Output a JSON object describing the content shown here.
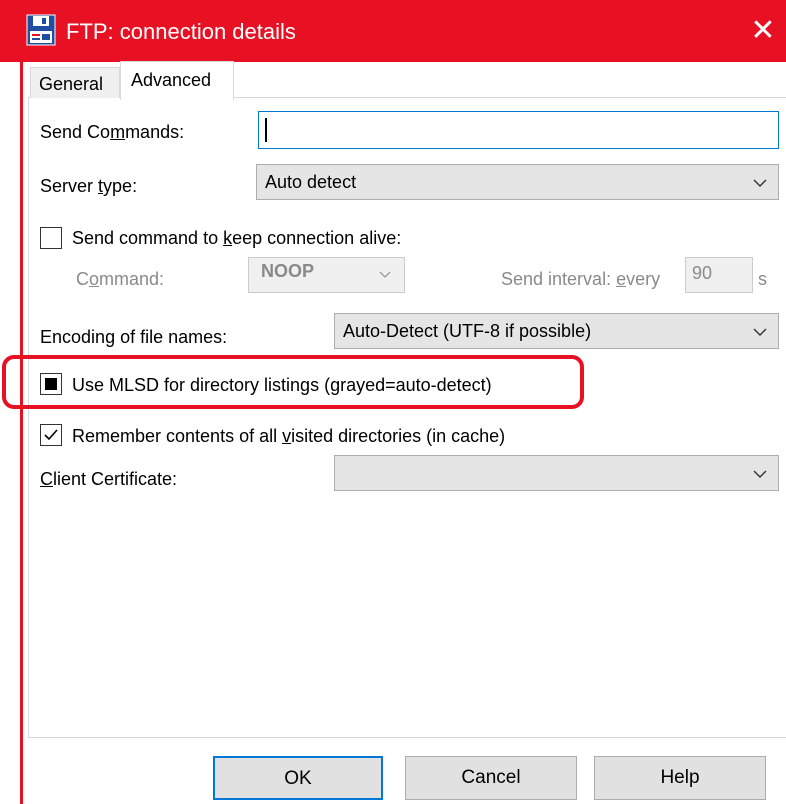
{
  "window": {
    "title": "FTP: connection details",
    "close_glyph": "✕",
    "accent_color": "#e81123",
    "icon": "floppy-disk-icon"
  },
  "tabs": [
    {
      "label": "General",
      "selected": false
    },
    {
      "label": "Advanced",
      "selected": true
    }
  ],
  "send_commands": {
    "label_pre": "Send Co",
    "label_u": "m",
    "label_post": "mands:",
    "value": ""
  },
  "server_type": {
    "label_pre": "Server ",
    "label_u": "t",
    "label_post": "ype:",
    "value": "Auto detect"
  },
  "keep_alive": {
    "label_pre": "Send command to ",
    "label_u": "k",
    "label_post": "eep connection alive:",
    "checked": false,
    "command_label_pre": "C",
    "command_label_u": "o",
    "command_label_post": "mmand:",
    "command_value": "NOOP",
    "interval_label_pre": "Send interval: ",
    "interval_label_u": "e",
    "interval_label_post": "very",
    "interval_value": "90",
    "interval_unit": "s"
  },
  "encoding": {
    "label_pre": "Encodin",
    "label_u": "g",
    "label_post": " of file names:",
    "value": "Auto-Detect (UTF-8 if possible)"
  },
  "mlsd": {
    "label": "Use MLSD for directory listings (grayed=auto-detect)",
    "state": "indeterminate"
  },
  "remember": {
    "label_pre": "Remember contents of all ",
    "label_u": "v",
    "label_post": "isited directories (in cache)",
    "checked": true
  },
  "client_cert": {
    "label_u": "C",
    "label_post": "lient Certificate:",
    "value": ""
  },
  "buttons": {
    "ok": "OK",
    "cancel": "Cancel",
    "help": "Help"
  }
}
